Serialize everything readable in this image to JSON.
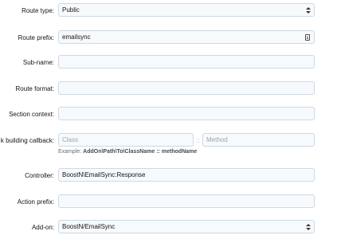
{
  "fields": {
    "route_type": {
      "label": "Route type:",
      "value": "Public"
    },
    "route_prefix": {
      "label": "Route prefix:",
      "value": "emailsync"
    },
    "sub_name": {
      "label": "Sub-name:",
      "value": ""
    },
    "route_format": {
      "label": "Route format:",
      "value": ""
    },
    "section_context": {
      "label": "Section context:",
      "value": ""
    },
    "link_callback": {
      "label": "k building callback:",
      "class_placeholder": "Class",
      "separator": "::",
      "method_placeholder": "Method",
      "example_prefix": "Example:",
      "example_value": "AddOn\\Path\\To\\ClassName :: methodName"
    },
    "controller": {
      "label": "Controller:",
      "value": "BoostN\\EmailSync:Response"
    },
    "action_prefix": {
      "label": "Action prefix:",
      "value": ""
    },
    "add_on": {
      "label": "Add-on:",
      "value": "BoostN/EmailSync"
    }
  },
  "icons": {
    "select": "up-down-caret-icon",
    "keyboard": "keyboard-icon"
  }
}
